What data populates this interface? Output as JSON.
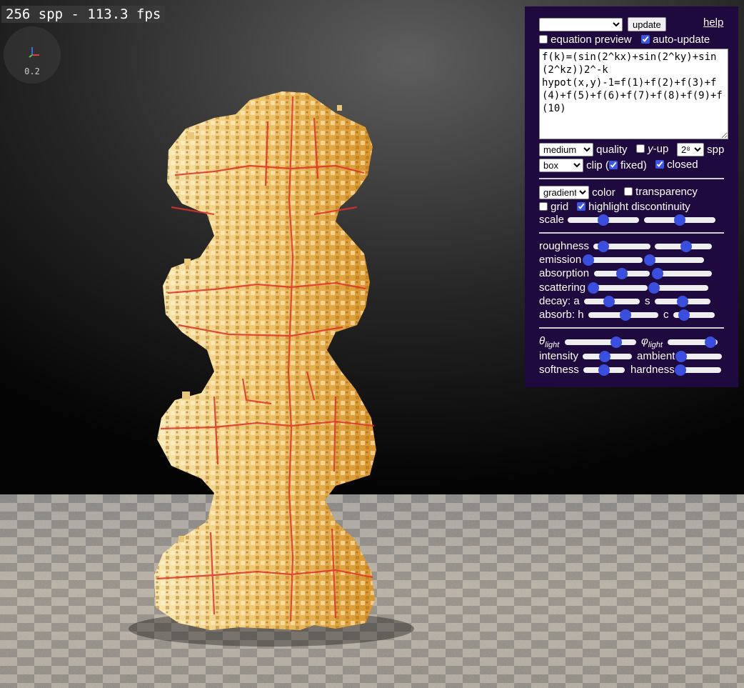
{
  "overlay": {
    "stats": "256 spp - 113.3 fps",
    "axes_scale": "0.2"
  },
  "panel": {
    "preset_value": "",
    "update_label": "update",
    "help_label": "help",
    "equation_preview_label": "equation preview",
    "equation_preview_checked": false,
    "auto_update_label": "auto-update",
    "auto_update_checked": true,
    "equation": "f(k)=(sin(2^kx)+sin(2^ky)+sin(2^kz))2^-k\nhypot(x,y)-1=f(1)+f(2)+f(3)+f(4)+f(5)+f(6)+f(7)+f(8)+f(9)+f(10)",
    "quality_value": "medium",
    "quality_label": "quality",
    "yup_label_var": "y",
    "yup_label_rest": "-up",
    "yup_checked": false,
    "spp_value": "2⁸",
    "spp_label": "spp",
    "clip_value": "box",
    "clip_label": "clip (",
    "fixed_label": "fixed)",
    "fixed_checked": true,
    "closed_label": "closed",
    "closed_checked": true,
    "color_value": "gradient",
    "color_label": "color",
    "transparency_label": "transparency",
    "transparency_checked": false,
    "grid_label": "grid",
    "grid_checked": false,
    "highlight_label": "highlight discontinuity",
    "highlight_checked": true,
    "scale_label": "scale",
    "roughness_label": "roughness",
    "emission_label": "emission",
    "absorption_label": "absorption",
    "scattering_label": "scattering",
    "decay_a_label": "decay: a",
    "decay_s_label": "s",
    "absorb_h_label": "absorb: h",
    "absorb_c_label": "c",
    "theta_label": "θ",
    "phi_label": "φ",
    "light_sub": "light",
    "intensity_label": "intensity",
    "ambient_label": "ambient",
    "softness_label": "softness",
    "hardness_label": "hardness"
  },
  "sliders": {
    "scale_1": 0.5,
    "scale_2": 0.5,
    "roughness_1": 0.18,
    "roughness_2": 0.55,
    "emission_1": 0.05,
    "emission_2": 0.05,
    "absorption_1": 0.5,
    "absorption_2": 0.05,
    "scattering_1": 0.05,
    "scattering_2": 0.05,
    "decay_a": 0.45,
    "decay_s": 0.5,
    "absorb_h": 0.53,
    "absorb_c": 0.25,
    "theta_light": 0.72,
    "phi_light": 0.85,
    "intensity": 0.45,
    "ambient": 0.05,
    "softness": 0.5,
    "hardness": 0.05
  }
}
